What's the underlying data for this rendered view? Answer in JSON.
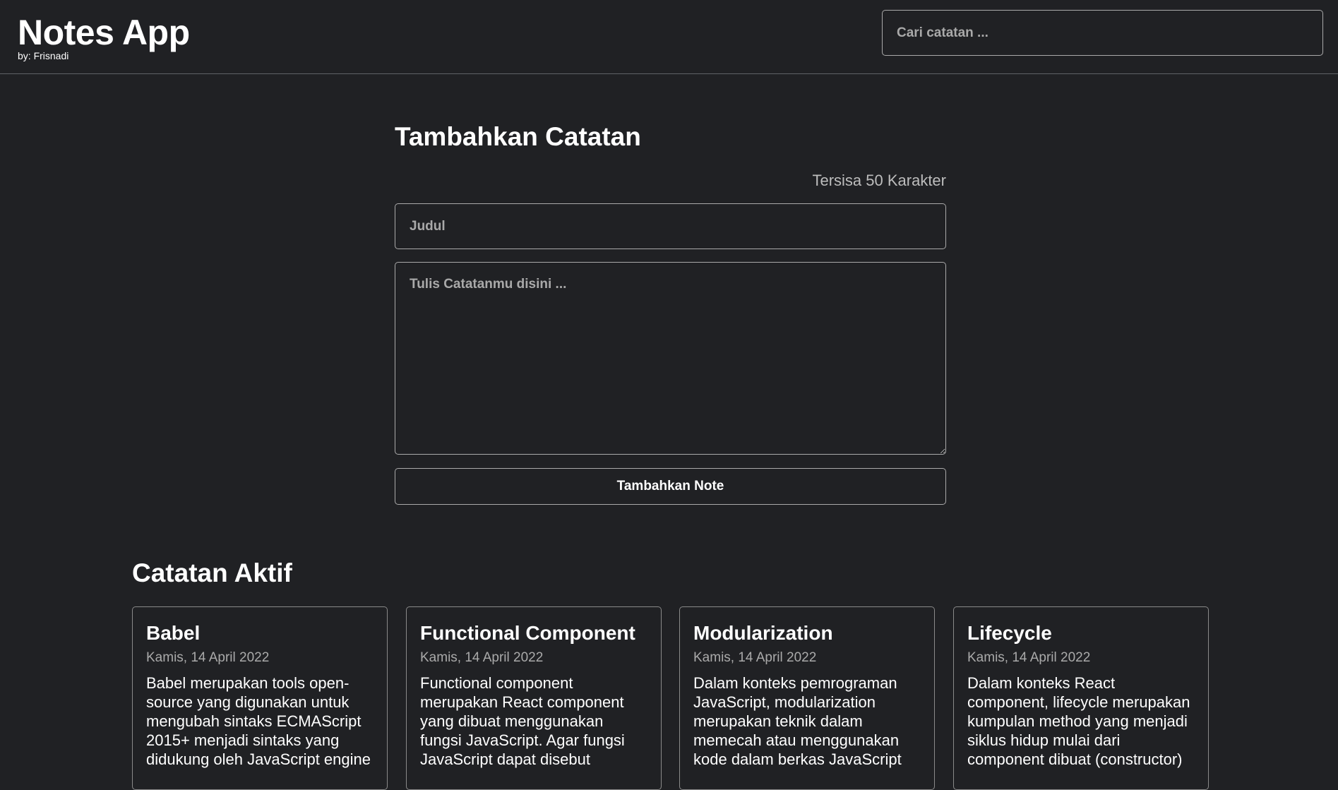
{
  "header": {
    "title": "Notes App",
    "author": "by: Frisnadi",
    "search_placeholder": "Cari catatan ..."
  },
  "form": {
    "title": "Tambahkan Catatan",
    "char_count": "Tersisa 50 Karakter",
    "title_placeholder": "Judul",
    "body_placeholder": "Tulis Catatanmu disini ...",
    "submit_label": "Tambahkan Note"
  },
  "active_notes": {
    "title": "Catatan Aktif",
    "notes": [
      {
        "title": "Babel",
        "date": "Kamis, 14 April 2022",
        "body": "Babel merupakan tools open-source yang digunakan untuk mengubah sintaks ECMAScript 2015+ menjadi sintaks yang didukung oleh JavaScript engine"
      },
      {
        "title": "Functional Component",
        "date": "Kamis, 14 April 2022",
        "body": "Functional component merupakan React component yang dibuat menggunakan fungsi JavaScript. Agar fungsi JavaScript dapat disebut"
      },
      {
        "title": "Modularization",
        "date": "Kamis, 14 April 2022",
        "body": "Dalam konteks pemrograman JavaScript, modularization merupakan teknik dalam memecah atau menggunakan kode dalam berkas JavaScript"
      },
      {
        "title": "Lifecycle",
        "date": "Kamis, 14 April 2022",
        "body": "Dalam konteks React component, lifecycle merupakan kumpulan method yang menjadi siklus hidup mulai dari component dibuat (constructor)"
      }
    ]
  }
}
